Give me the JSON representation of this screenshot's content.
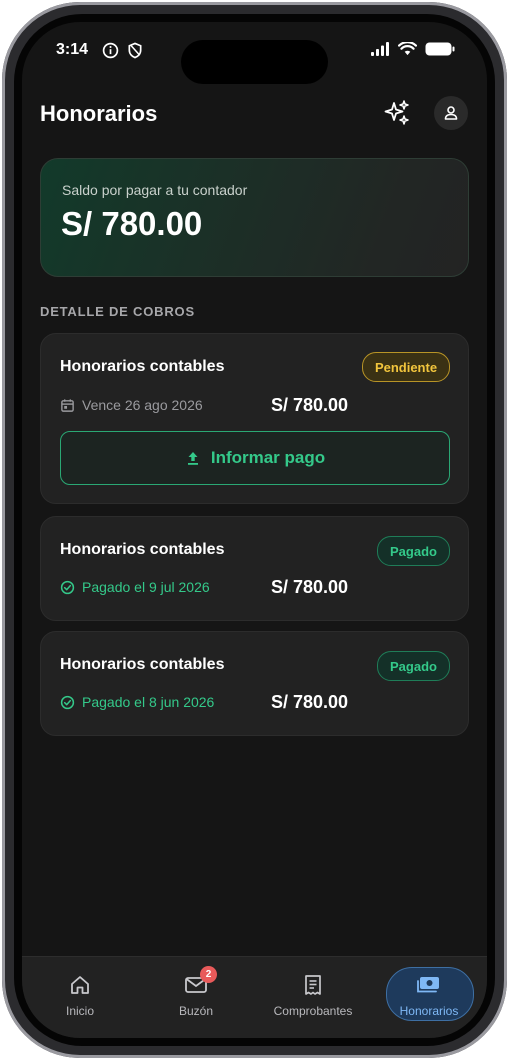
{
  "status_bar": {
    "time": "3:14"
  },
  "header": {
    "title": "Honorarios"
  },
  "balance": {
    "label": "Saldo por pagar a tu contador",
    "amount": "S/ 780.00"
  },
  "section": {
    "title": "DETALLE DE COBROS"
  },
  "charges": [
    {
      "title": "Honorarios contables",
      "status": "Pendiente",
      "meta": "Vence 26 ago 2026",
      "amount": "S/ 780.00",
      "action": "Informar pago"
    },
    {
      "title": "Honorarios contables",
      "status": "Pagado",
      "meta": "Pagado el 9 jul 2026",
      "amount": "S/ 780.00"
    },
    {
      "title": "Honorarios contables",
      "status": "Pagado",
      "meta": "Pagado el 8 jun 2026",
      "amount": "S/ 780.00"
    }
  ],
  "bottom_nav": {
    "items": [
      {
        "label": "Inicio",
        "icon": "home-icon"
      },
      {
        "label": "Buzón",
        "icon": "mail-icon",
        "badge": "2"
      },
      {
        "label": "Comprobantes",
        "icon": "receipt-icon"
      },
      {
        "label": "Honorarios",
        "icon": "cash-icon",
        "active": true
      }
    ]
  },
  "colors": {
    "accent_green": "#34c98a",
    "pending_yellow": "#f2c53d",
    "active_blue": "#7fb8f5",
    "badge_red": "#e85a5a"
  }
}
